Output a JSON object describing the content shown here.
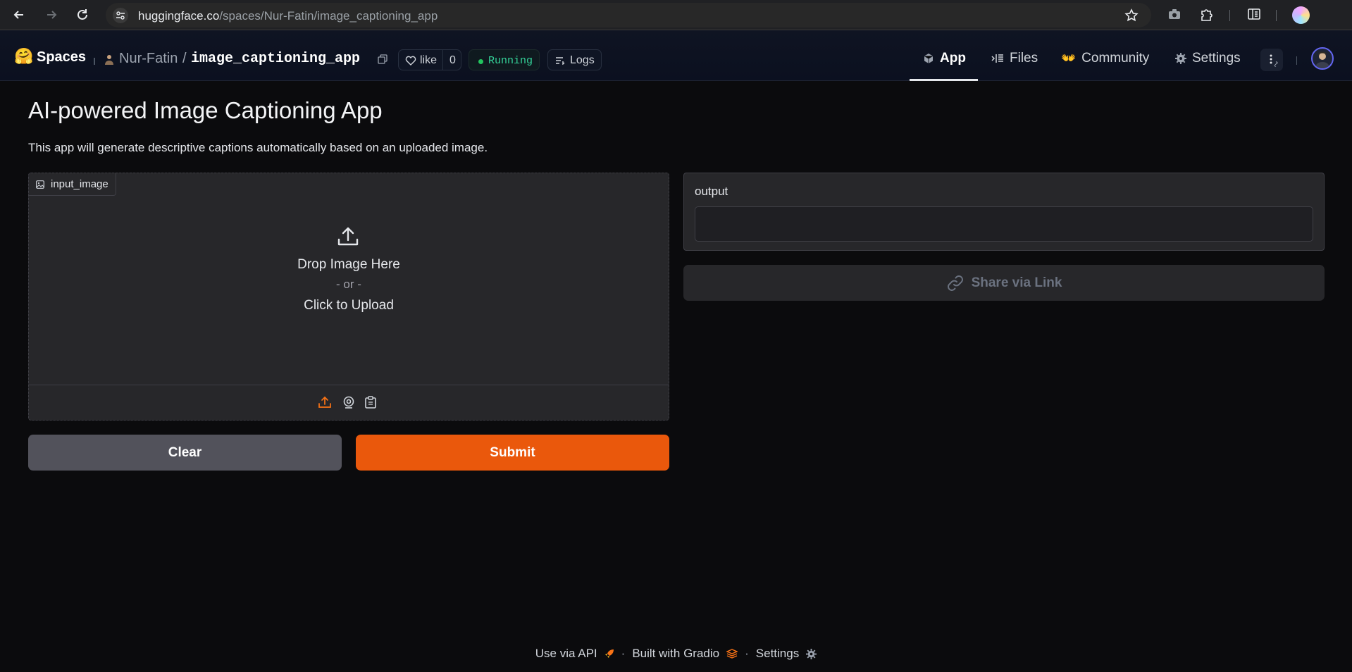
{
  "browser": {
    "url_host": "huggingface.co",
    "url_path": "/spaces/Nur-Fatin/image_captioning_app"
  },
  "header": {
    "logo": "🤗",
    "spaces_label": "Spaces",
    "owner": "Nur-Fatin",
    "separator": "/",
    "repo": "image_captioning_app",
    "like_label": "like",
    "like_count": "0",
    "status": "Running",
    "logs_label": "Logs",
    "tabs": [
      {
        "label": "App",
        "active": true
      },
      {
        "label": "Files",
        "active": false
      },
      {
        "label": "Community",
        "active": false
      },
      {
        "label": "Settings",
        "active": false
      }
    ]
  },
  "main": {
    "title": "AI-powered Image Captioning App",
    "description": "This app will generate descriptive captions automatically based on an uploaded image.",
    "input": {
      "label": "input_image",
      "drop_text": "Drop Image Here",
      "or_text": "- or -",
      "click_text": "Click to Upload"
    },
    "output": {
      "label": "output",
      "value": ""
    },
    "buttons": {
      "clear": "Clear",
      "submit": "Submit",
      "share": "Share via Link"
    }
  },
  "footer": {
    "api": "Use via API",
    "gradio": "Built with Gradio",
    "settings": "Settings",
    "dot": "·"
  },
  "colors": {
    "accent": "#ea580c",
    "status": "#34d399",
    "background": "#0b0b0d"
  }
}
